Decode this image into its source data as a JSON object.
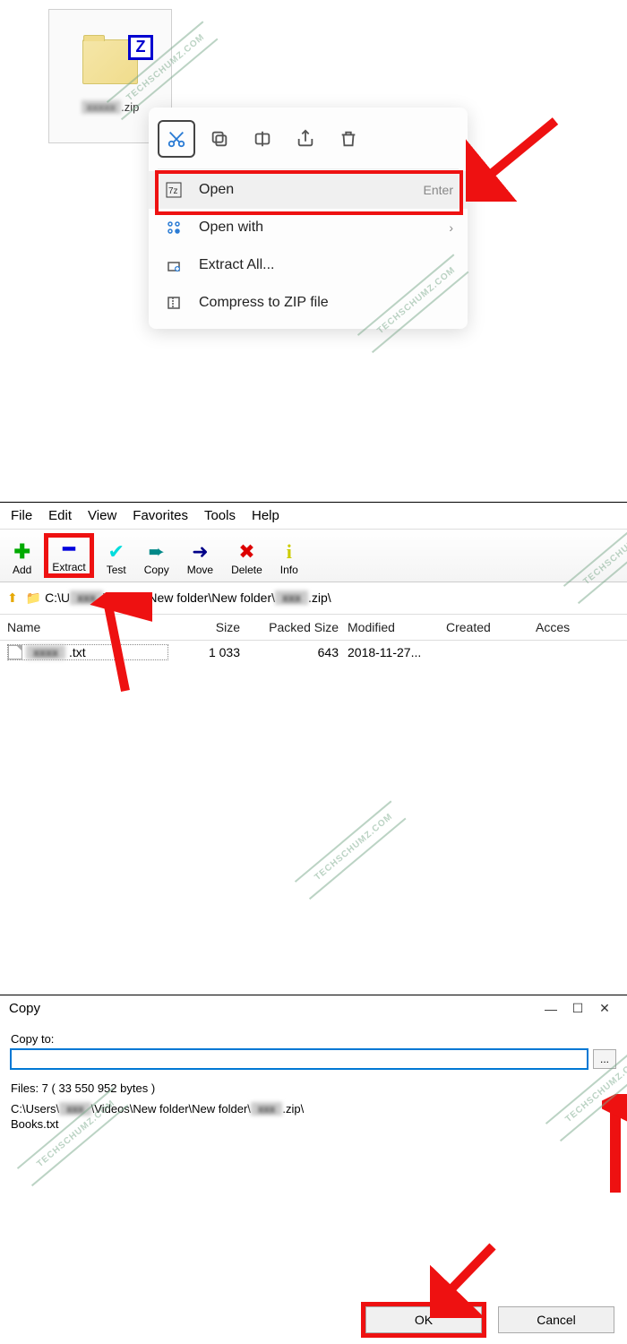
{
  "section1": {
    "zip_filename_ext": ".zip",
    "z_badge": "Z",
    "toolbar_icons": [
      "cut",
      "copy",
      "rename",
      "share",
      "delete"
    ],
    "menu": {
      "open": {
        "label": "Open",
        "shortcut": "Enter"
      },
      "open_with": {
        "label": "Open with"
      },
      "extract_all": {
        "label": "Extract All..."
      },
      "compress": {
        "label": "Compress to ZIP file"
      }
    }
  },
  "section2": {
    "menubar": {
      "file": "File",
      "edit": "Edit",
      "view": "View",
      "favorites": "Favorites",
      "tools": "Tools",
      "help": "Help"
    },
    "toolbar": {
      "add": "Add",
      "extract": "Extract",
      "test": "Test",
      "copy": "Copy",
      "move": "Move",
      "delete": "Delete",
      "info": "Info"
    },
    "path_prefix": "C:\\U",
    "path_mid": "\\Videos\\New folder\\New folder\\",
    "path_suffix": ".zip\\",
    "headers": {
      "name": "Name",
      "size": "Size",
      "packed": "Packed Size",
      "modified": "Modified",
      "created": "Created",
      "access": "Acces"
    },
    "row": {
      "name_ext": ".txt",
      "size": "1 033",
      "packed": "643",
      "modified": "2018-11-27..."
    }
  },
  "section3": {
    "title": "Copy",
    "copy_to_label": "Copy to:",
    "files_info": "Files: 7 ( 33 550 952 bytes )",
    "path_line_prefix": "C:\\Users\\",
    "path_line_mid": "\\Videos\\New folder\\New folder\\",
    "path_line_suffix": ".zip\\",
    "file_line": "Books.txt",
    "browse_label": "...",
    "ok": "OK",
    "cancel": "Cancel"
  },
  "watermark_text": "TECHSCHUMZ.COM"
}
